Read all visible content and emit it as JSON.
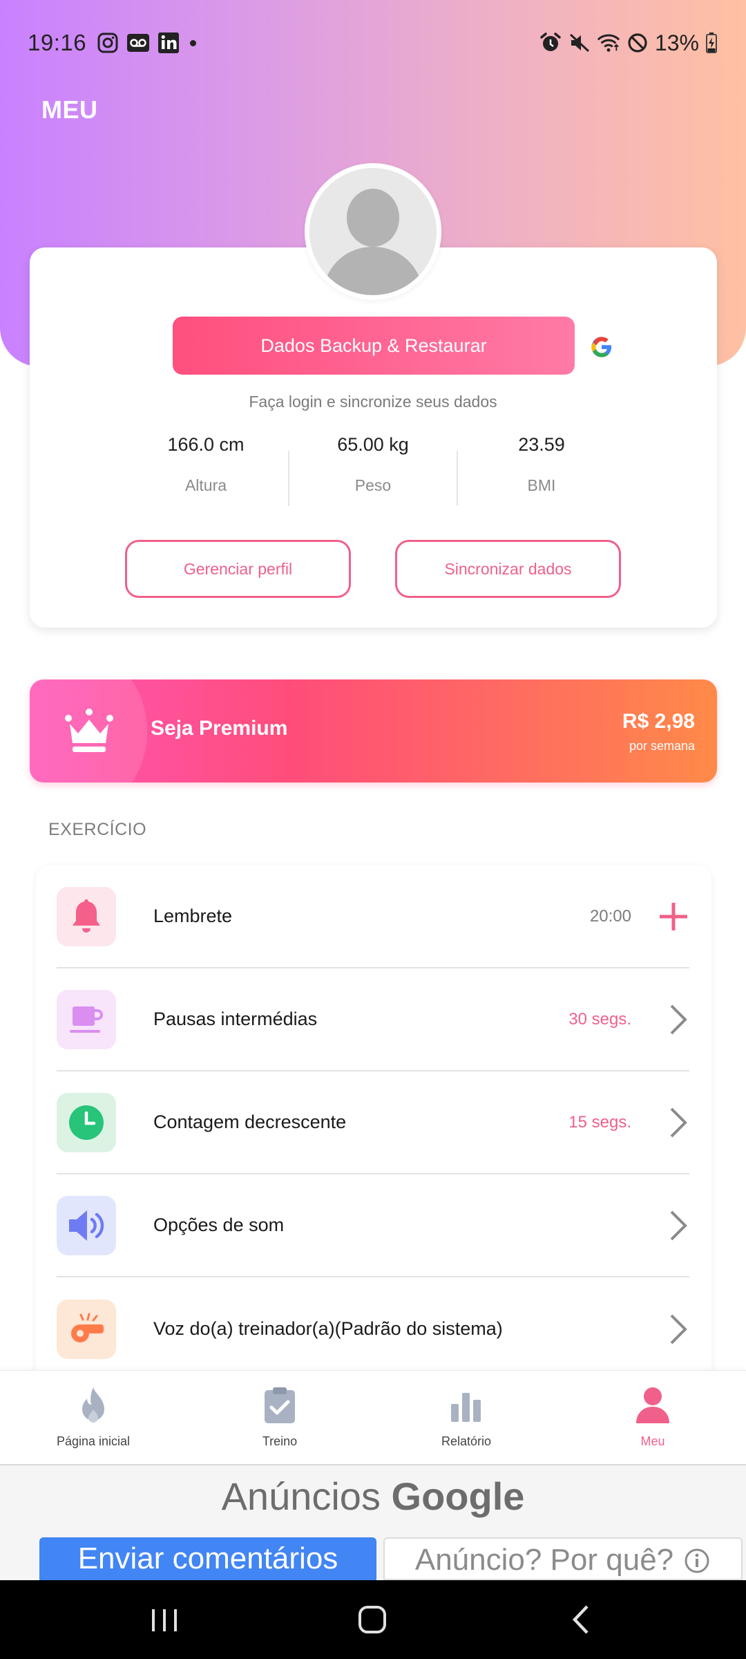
{
  "status_bar": {
    "time": "19:16",
    "battery": "13%",
    "left_icons": [
      "instagram-icon",
      "voicemail-icon",
      "linkedin-icon"
    ],
    "right_icons": [
      "alarm-icon",
      "mute-icon",
      "wifi-icon",
      "do-not-disturb-icon",
      "battery-charging-icon"
    ]
  },
  "header": {
    "title": "MEU"
  },
  "profile": {
    "backup_button": "Dados Backup & Restaurar",
    "login_hint": "Faça login e sincronize seus dados",
    "stats": [
      {
        "value": "166.0 cm",
        "label": "Altura"
      },
      {
        "value": "65.00 kg",
        "label": "Peso"
      },
      {
        "value": "23.59",
        "label": "BMI"
      }
    ],
    "manage_button": "Gerenciar perfil",
    "sync_button": "Sincronizar dados"
  },
  "premium": {
    "title": "Seja Premium",
    "price": "R$ 2,98",
    "period": "por semana"
  },
  "section": {
    "title": "EXERCÍCIO"
  },
  "settings": [
    {
      "label": "Lembrete",
      "value": "20:00",
      "icon": "bell-icon",
      "action": "add-icon"
    },
    {
      "label": "Pausas intermédias",
      "value": "30 segs.",
      "icon": "coffee-cup-icon",
      "action": "chevron-right-icon"
    },
    {
      "label": "Contagem decrescente",
      "value": "15 segs.",
      "icon": "clock-icon",
      "action": "chevron-right-icon"
    },
    {
      "label": "Opções de som",
      "value": "",
      "icon": "speaker-icon",
      "action": "chevron-right-icon"
    },
    {
      "label": "Voz do(a) treinador(a)(Padrão do sistema)",
      "value": "",
      "icon": "whistle-icon",
      "action": "chevron-right-icon"
    }
  ],
  "colors": {
    "accent": "#f0608a",
    "header_gradient_start": "#c981ff",
    "header_gradient_end": "#ffc0a3",
    "premium_gradient_start": "#ff56b8",
    "premium_gradient_end": "#ff8a48"
  },
  "bottom_nav": [
    {
      "label": "Página inicial",
      "icon": "flame-icon",
      "active": false
    },
    {
      "label": "Treino",
      "icon": "clipboard-check-icon",
      "active": false
    },
    {
      "label": "Relatório",
      "icon": "bar-chart-icon",
      "active": false
    },
    {
      "label": "Meu",
      "icon": "person-icon",
      "active": true
    }
  ],
  "ad": {
    "label_prefix": "Anúncios",
    "label_brand": "Google",
    "feedback_button": "Enviar comentários",
    "why_button": "Anúncio? Por quê?"
  }
}
